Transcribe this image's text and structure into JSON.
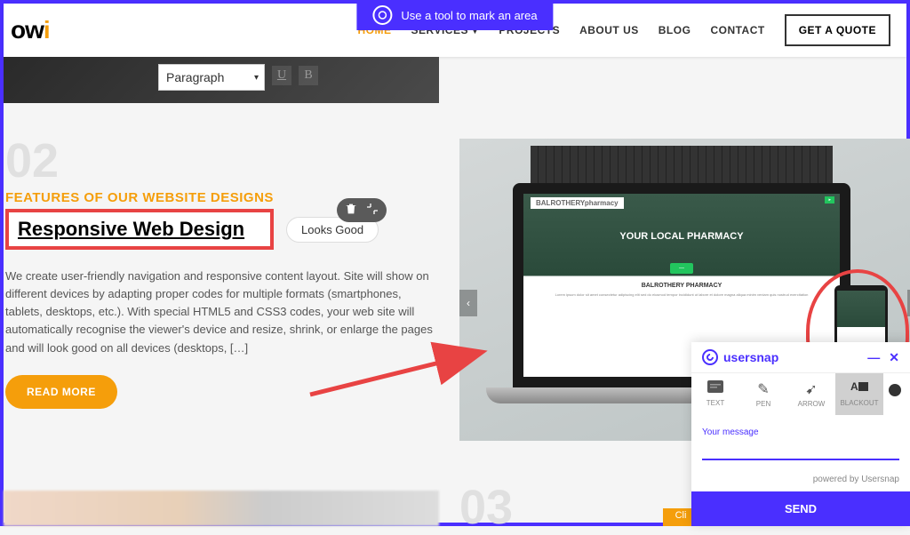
{
  "banner": {
    "text": "Use a tool to mark an area"
  },
  "header": {
    "logo_main": "ow",
    "logo_accent": "i",
    "nav": {
      "home": "HOME",
      "services": "SERVICES",
      "projects": "PROJECTS",
      "about": "ABOUT US",
      "blog": "BLOG",
      "contact": "CONTACT"
    },
    "quote": "GET A QUOTE"
  },
  "editor_strip": {
    "dropdown": "Paragraph"
  },
  "section02": {
    "number": "02",
    "subtitle": "FEATURES OF OUR WEBSITE DESIGNS",
    "title": "Responsive Web Design",
    "comment": "Looks Good",
    "body": "We create user-friendly navigation and responsive content layout. Site will show on different devices by adapting proper codes for multiple formats (smartphones, tablets, desktops, etc.). With special HTML5 and CSS3 codes, your web site will automatically recognise the viewer's device and resize, shrink, or enlarge the pages and will look good on all devices (desktops, […]",
    "read_more": "READ MORE"
  },
  "laptop_preview": {
    "brand": "BALROTHERYpharmacy",
    "hero": "YOUR LOCAL PHARMACY",
    "body_title": "BALROTHERY PHARMACY"
  },
  "section03": {
    "number": "03",
    "btn": "Cli"
  },
  "usersnap": {
    "brand": "usersnap",
    "tools": {
      "text": "TEXT",
      "pen": "PEN",
      "arrow": "ARROW",
      "blackout": "BLACKOUT"
    },
    "message_label": "Your message",
    "message_value": "",
    "powered": "powered by Usersnap",
    "send": "SEND"
  },
  "colors": {
    "primary": "#4a2fff",
    "accent": "#f59e0b",
    "annotation": "#e84343"
  }
}
